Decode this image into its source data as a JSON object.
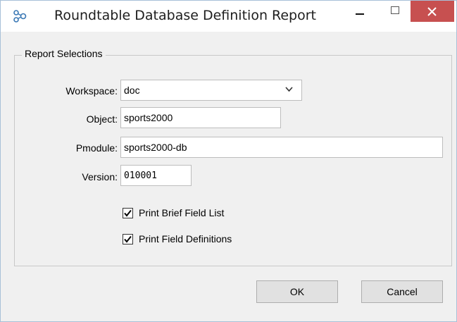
{
  "window": {
    "title": "Roundtable Database Definition Report"
  },
  "group": {
    "label": "Report Selections"
  },
  "fields": {
    "workspace": {
      "label": "Workspace:",
      "value": "doc"
    },
    "object": {
      "label": "Object:",
      "value": "sports2000"
    },
    "pmodule": {
      "label": "Pmodule:",
      "value": "sports2000-db"
    },
    "version": {
      "label": "Version:",
      "value": "010001"
    }
  },
  "options": {
    "brief": {
      "label": "Print Brief Field List",
      "checked": true
    },
    "definitions": {
      "label": "Print Field Definitions",
      "checked": true
    }
  },
  "buttons": {
    "ok": "OK",
    "cancel": "Cancel"
  },
  "colors": {
    "close_button": "#c75050",
    "window_bg": "#f0f0f0"
  }
}
